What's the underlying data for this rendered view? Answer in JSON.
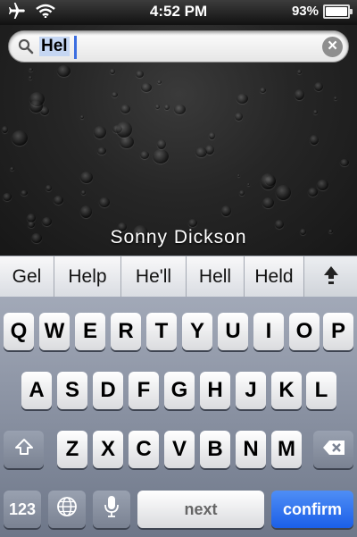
{
  "status_bar": {
    "time": "4:52 PM",
    "battery_text": "93%",
    "battery_level": 0.93,
    "icons": [
      "airplane-icon",
      "wifi-icon",
      "battery-icon"
    ]
  },
  "search": {
    "query": "Hel"
  },
  "watermark": "Sonny Dickson",
  "suggestions": [
    "Gel",
    "Help",
    "He'll",
    "Hell",
    "Held"
  ],
  "keyboard": {
    "row1": [
      "Q",
      "W",
      "E",
      "R",
      "T",
      "Y",
      "U",
      "I",
      "O",
      "P"
    ],
    "row2": [
      "A",
      "S",
      "D",
      "F",
      "G",
      "H",
      "J",
      "K",
      "L"
    ],
    "row3": [
      "Z",
      "X",
      "C",
      "V",
      "B",
      "N",
      "M"
    ],
    "numbers_label": "123",
    "space_label": "next",
    "confirm_label": "confirm"
  },
  "colors": {
    "confirm_key": "#1b5fe8",
    "selection": "#c5d6f2",
    "caret": "#3c6ee0"
  }
}
